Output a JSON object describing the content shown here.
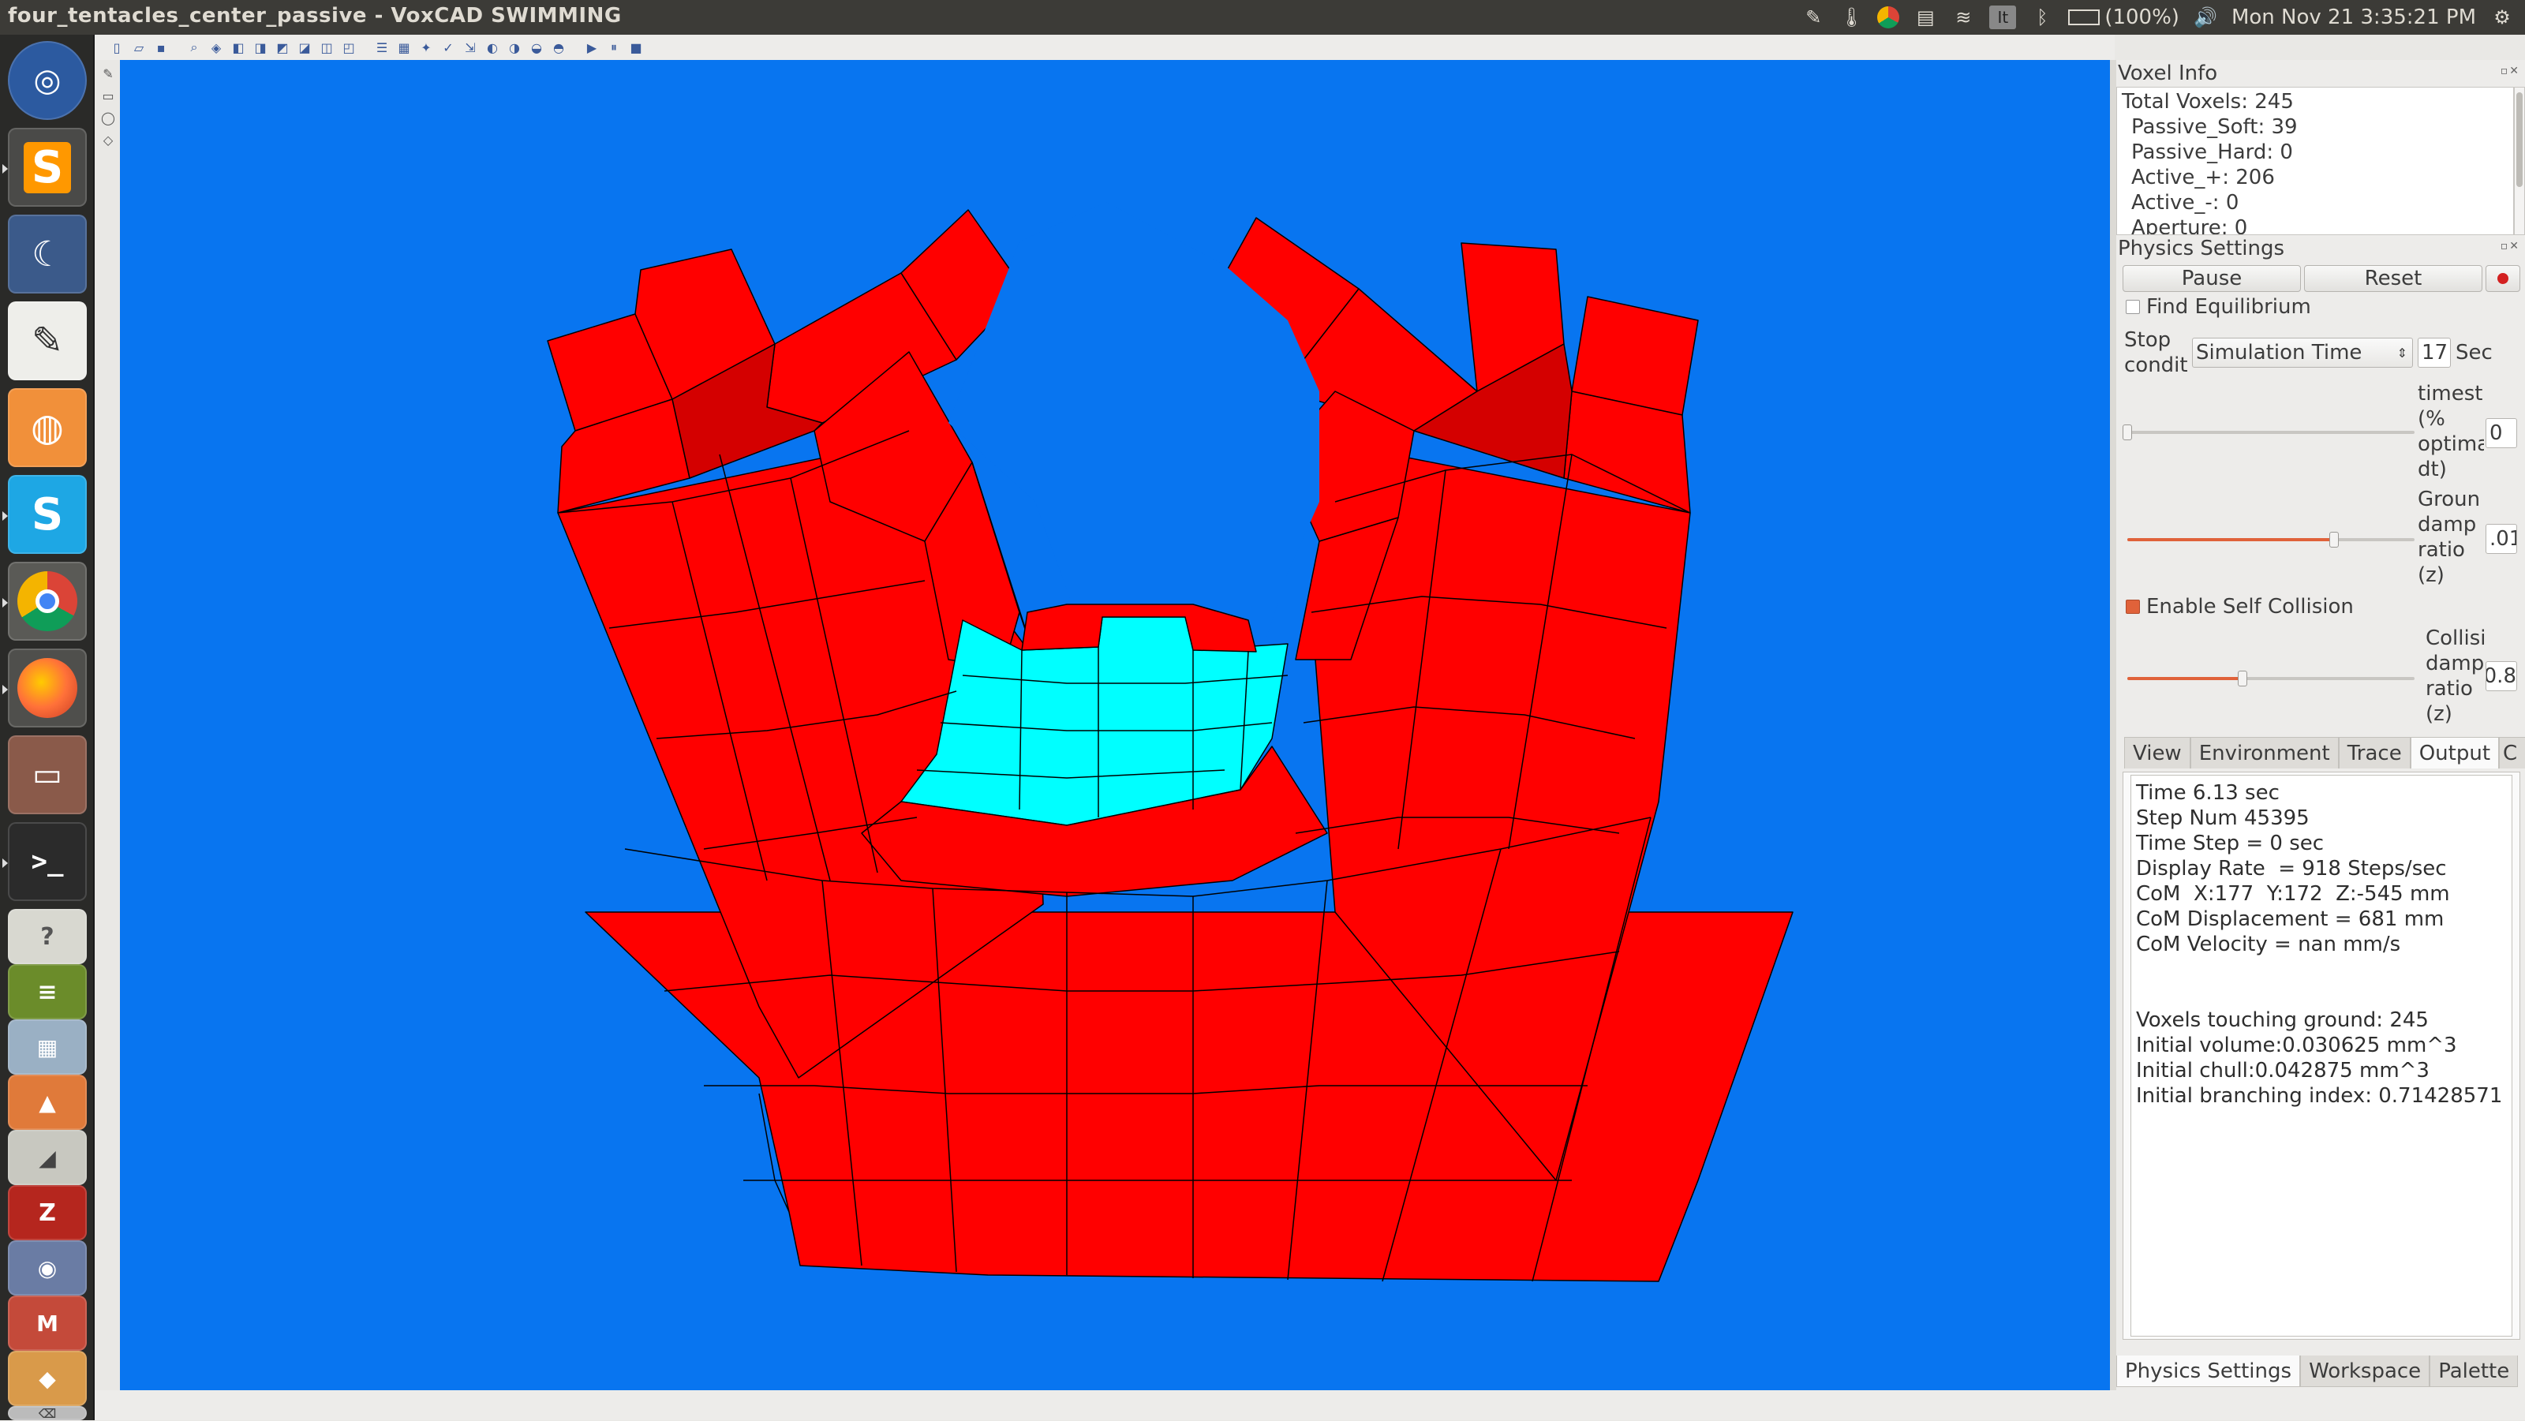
{
  "window_title": "four_tentacles_center_passive - VoxCAD SWIMMING",
  "tray": {
    "battery": "(100%)",
    "clock": "Mon Nov 21  3:35:21 PM",
    "keyboard": "It"
  },
  "launcher": {
    "items": [
      "ubuntu-dash-icon",
      "sublime-text-icon",
      "eclipse-icon",
      "text-editor-icon",
      "sync-icon",
      "skype-icon",
      "chrome-icon",
      "firefox-icon",
      "files-icon",
      "terminal-icon",
      "app-icon",
      "spotify-icon",
      "app-icon",
      "app-icon",
      "app-icon",
      "filezilla-icon",
      "app-icon",
      "app-icon",
      "app-icon",
      "trash-icon"
    ],
    "skype_letter": "S",
    "sublime_letter": "S",
    "terminal_prompt": ">_"
  },
  "viewport": {
    "background": "#0875f0",
    "active_color": "#ff0000",
    "passive_color": "#00ffff"
  },
  "voxel_info": {
    "title": "Voxel Info",
    "total": "Total Voxels: 245",
    "passive_soft": "Passive_Soft: 39",
    "passive_hard": "Passive_Hard: 0",
    "active_plus": "Active_+: 206",
    "active_minus": "Active_-: 0",
    "aperture": "Aperture: 0"
  },
  "physics": {
    "title": "Physics Settings",
    "pause": "Pause",
    "reset": "Reset",
    "find_equilibrium": "Find Equilibrium",
    "stop_label_1": "Stop",
    "stop_label_2": "condit",
    "stop_select": "Simulation Time",
    "stop_value": "17",
    "stop_unit": "Sec",
    "timestep_l1": "timest",
    "timestep_l2": "(%",
    "timestep_l3": "optima",
    "timestep_l4": "dt)",
    "timestep_value": "0",
    "timestep_pct": 0,
    "ground_l1": "Groun",
    "ground_l2": "damp",
    "ground_l3": "ratio",
    "ground_l4": "(z)",
    "ground_value": ".01",
    "ground_pct": 0.72,
    "self_collision": "Enable Self Collision",
    "coll_l1": "Collisi",
    "coll_l2": "damp",
    "coll_l3": "ratio",
    "coll_l4": "(z)",
    "coll_value": "0.8",
    "coll_pct": 0.4
  },
  "tabs": [
    "View",
    "Environment",
    "Trace",
    "Output",
    "C"
  ],
  "output": {
    "time": "Time 6.13 sec",
    "step_num": "Step Num 45395",
    "time_step": "Time Step = 0 sec",
    "display_rate": "Display Rate  = 918 Steps/sec",
    "com": "CoM  X:177  Y:172  Z:-545 mm",
    "com_disp": "CoM Displacement = 681 mm",
    "com_vel": "CoM Velocity = nan mm/s",
    "touching": "Voxels touching ground: 245",
    "init_volume": "Initial volume:0.030625 mm^3",
    "init_chull": "Initial chull:0.042875 mm^3",
    "init_branch": "Initial branching index: 0.71428571"
  },
  "bottom_tabs": [
    "Physics Settings",
    "Workspace",
    "Palette"
  ]
}
